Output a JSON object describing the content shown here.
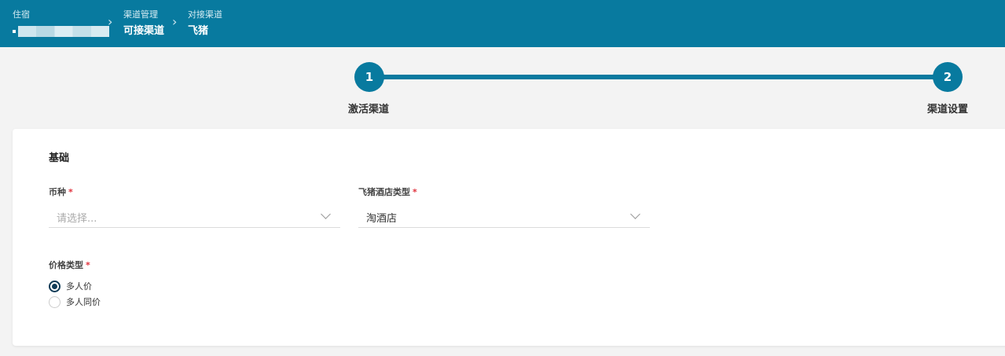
{
  "header": {
    "crumb1": {
      "small": "住宿",
      "big": ""
    },
    "crumb2": {
      "small": "渠道管理",
      "big": "可接渠道"
    },
    "crumb3": {
      "small": "对接渠道",
      "big": "飞猪"
    }
  },
  "stepper": {
    "steps": [
      {
        "number": "1",
        "label": "激活渠道"
      },
      {
        "number": "2",
        "label": "渠道设置"
      }
    ]
  },
  "form": {
    "section_title": "基础",
    "currency": {
      "label": "币种",
      "required": "*",
      "placeholder": "请选择...",
      "value": ""
    },
    "hotel_type": {
      "label": "飞猪酒店类型",
      "required": "*",
      "value": "淘酒店"
    },
    "price_type": {
      "label": "价格类型",
      "required": "*",
      "options": [
        {
          "label": "多人价",
          "checked": true
        },
        {
          "label": "多人同价",
          "checked": false
        }
      ]
    }
  },
  "colors": {
    "accent": "#087a9f",
    "required": "#e0303b",
    "radio": "#0f3b57"
  }
}
